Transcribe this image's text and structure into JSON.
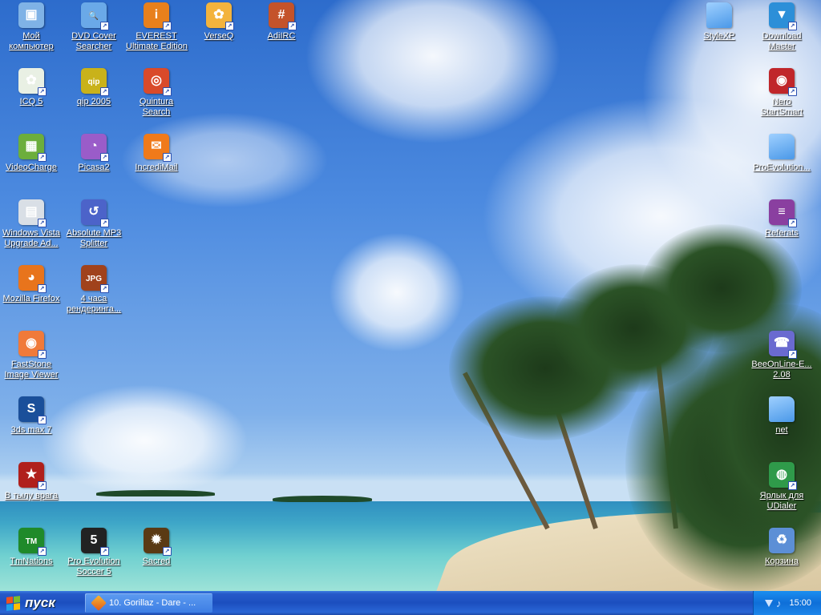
{
  "desktop": {
    "icons": [
      {
        "name": "my-computer",
        "lines": [
          "Мой",
          "компьютер"
        ],
        "icon": "computer-icon",
        "color": "#7fb2e6",
        "symbol": "▣"
      },
      {
        "name": "dvd-cover-searcher",
        "lines": [
          "DVD Cover",
          "Searcher"
        ],
        "icon": "magnifier-window-icon",
        "color": "#6aa9e8",
        "symbol": "🔍"
      },
      {
        "name": "everest",
        "lines": [
          "EVEREST",
          "Ultimate Edition"
        ],
        "icon": "info-icon",
        "color": "#e8801c",
        "symbol": "i"
      },
      {
        "name": "verseq",
        "lines": [
          "VerseQ"
        ],
        "icon": "shell-icon",
        "color": "#f3b33d",
        "symbol": "✿"
      },
      {
        "name": "adiirc",
        "lines": [
          "AdiIRC"
        ],
        "icon": "hash-icon",
        "color": "#c4532a",
        "symbol": "#"
      },
      {
        "name": "stylexp",
        "lines": [
          "StyleXP"
        ],
        "icon": "folder-icon",
        "color": "#4a98e8",
        "symbol": ""
      },
      {
        "name": "download-master",
        "lines": [
          "Download",
          "Master"
        ],
        "icon": "download-master-icon",
        "color": "#2c8fd8",
        "symbol": "▼"
      },
      {
        "name": "icq-5",
        "lines": [
          "ICQ 5"
        ],
        "icon": "icq-flower-icon",
        "color": "#e9f0e4",
        "symbol": "✿"
      },
      {
        "name": "qip-2005",
        "lines": [
          "qip 2005"
        ],
        "icon": "qip-icon",
        "color": "#c9b21a",
        "symbol": "qip"
      },
      {
        "name": "quintura-search",
        "lines": [
          "Quintura",
          "Search"
        ],
        "icon": "globe-search-icon",
        "color": "#d94a2a",
        "symbol": "◎"
      },
      {
        "name": "nero-startsmart",
        "lines": [
          "Nero",
          "StartSmart"
        ],
        "icon": "nero-flame-icon",
        "color": "#c0262a",
        "symbol": "◉"
      },
      {
        "name": "videocharge",
        "lines": [
          "VideoCharge"
        ],
        "icon": "film-icon",
        "color": "#6cae3c",
        "symbol": "▦"
      },
      {
        "name": "picasa2",
        "lines": [
          "Picasa2"
        ],
        "icon": "picasa-icon",
        "color": "#9a5cc9",
        "symbol": "◔"
      },
      {
        "name": "incredimail",
        "lines": [
          "IncrediMail"
        ],
        "icon": "envelope-icon",
        "color": "#f07a1a",
        "symbol": "✉"
      },
      {
        "name": "proevolution-folder",
        "lines": [
          "ProEvolution..."
        ],
        "icon": "folder-icon",
        "color": "#4a98e8",
        "symbol": ""
      },
      {
        "name": "windows-vista-upgrade",
        "lines": [
          "Windows Vista",
          "Upgrade Ad..."
        ],
        "icon": "document-window-icon",
        "color": "#d9dfe6",
        "symbol": "▤"
      },
      {
        "name": "absolute-mp3-splitter",
        "lines": [
          "Absolute MP3",
          "Splitter"
        ],
        "icon": "splitter-disc-icon",
        "color": "#4c63c9",
        "symbol": "↺"
      },
      {
        "name": "referats",
        "lines": [
          "Referats"
        ],
        "icon": "winrar-archive-icon",
        "color": "#8a3fa0",
        "symbol": "≡"
      },
      {
        "name": "mozilla-firefox",
        "lines": [
          "Mozilla Firefox"
        ],
        "icon": "firefox-icon",
        "color": "#e8741c",
        "symbol": "◕"
      },
      {
        "name": "4-chasa-renderinga",
        "lines": [
          "4 часа",
          "рендеринга..."
        ],
        "icon": "jpg-image-icon",
        "color": "#a0421c",
        "symbol": "JPG"
      },
      {
        "name": "faststone-image-viewer",
        "lines": [
          "FastStone",
          "Image Viewer"
        ],
        "icon": "eye-icon",
        "color": "#f07a3a",
        "symbol": "◉"
      },
      {
        "name": "beeonline",
        "lines": [
          "BeeOnLine-E...",
          "2.08"
        ],
        "icon": "mobile-phone-icon",
        "color": "#6a6ad0",
        "symbol": "☎"
      },
      {
        "name": "3ds-max-7",
        "lines": [
          "3ds max 7"
        ],
        "icon": "3ds-max-icon",
        "color": "#1a4f9a",
        "symbol": "S"
      },
      {
        "name": "net-folder",
        "lines": [
          "net"
        ],
        "icon": "folder-icon",
        "color": "#4a98e8",
        "symbol": ""
      },
      {
        "name": "v-tylu-vraga",
        "lines": [
          "В тылу врага"
        ],
        "icon": "red-star-icon",
        "color": "#b0201c",
        "symbol": "★"
      },
      {
        "name": "udialer-shortcut",
        "lines": [
          "Ярлык для",
          "UDialer"
        ],
        "icon": "network-globe-icon",
        "color": "#2f9a4a",
        "symbol": "◍"
      },
      {
        "name": "tmnations",
        "lines": [
          "TmNations"
        ],
        "icon": "tmnations-icon",
        "color": "#1f8a2a",
        "symbol": "TM"
      },
      {
        "name": "pro-evolution-soccer-5",
        "lines": [
          "Pro Evolution",
          "Soccer 5"
        ],
        "icon": "pes5-icon",
        "color": "#222222",
        "symbol": "5"
      },
      {
        "name": "sacred",
        "lines": [
          "Sacred"
        ],
        "icon": "sacred-emblem-icon",
        "color": "#5a3a14",
        "symbol": "✹"
      },
      {
        "name": "recycle-bin",
        "lines": [
          "Корзина"
        ],
        "icon": "recycle-bin-icon",
        "color": "#5c8fd6",
        "symbol": "♻"
      }
    ]
  },
  "taskbar": {
    "start_label": "пуск",
    "start_flag_colors": [
      "#f0501e",
      "#7cbd2a",
      "#1ea0ec",
      "#ffbf00"
    ],
    "tasks": [
      {
        "label": "10. Gorillaz - Dare - ..."
      }
    ],
    "clock": "15:00"
  }
}
